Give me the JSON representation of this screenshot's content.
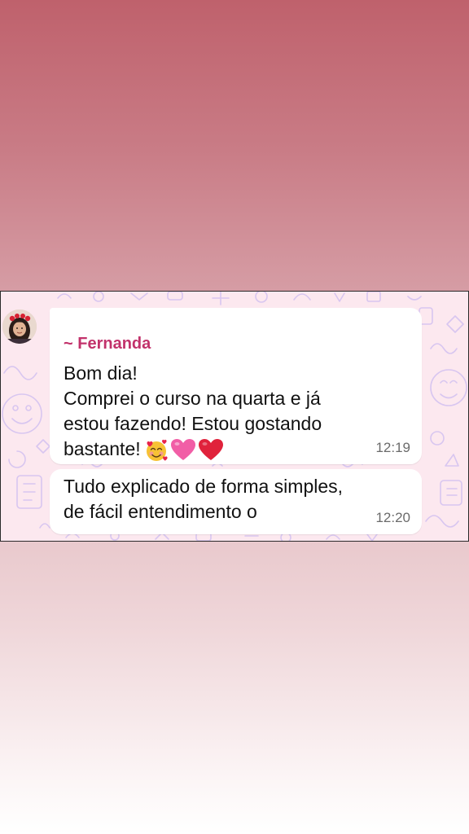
{
  "chat": {
    "sender": "~ Fernanda",
    "messages": [
      {
        "lines": [
          "Bom dia!",
          "Comprei o curso na quarta e já",
          "estou fazendo! Estou gostando",
          "bastante!"
        ],
        "emojis": [
          "smiling-face-with-hearts-icon",
          "pink-heart-icon",
          "red-heart-icon"
        ],
        "time": "12:19"
      },
      {
        "lines": [
          "Tudo explicado de forma simples,",
          "de fácil entendimento o"
        ],
        "time": "12:20"
      }
    ]
  },
  "colors": {
    "sender_name": "#c2326b",
    "chat_background": "#fce8ef",
    "bubble": "#ffffff",
    "pattern": "#d8c6f0"
  }
}
